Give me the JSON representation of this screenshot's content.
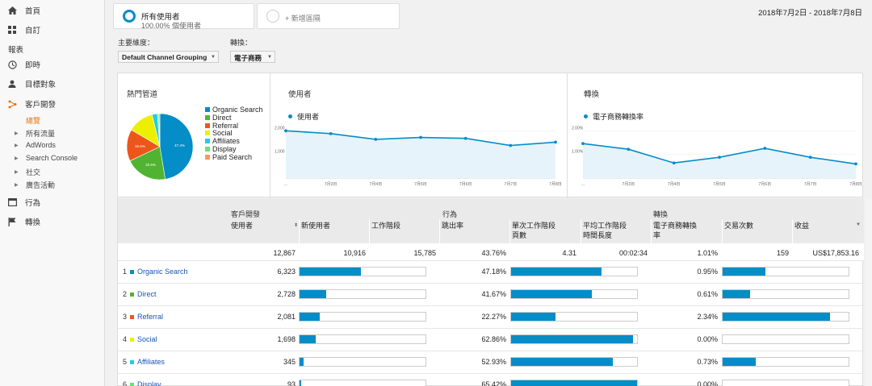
{
  "sidebar": {
    "items": [
      {
        "label": "首頁",
        "icon": "home-icon"
      },
      {
        "label": "自訂",
        "icon": "grid-icon"
      },
      {
        "label": "即時",
        "icon": "clock-icon"
      },
      {
        "label": "目標對象",
        "icon": "person-icon"
      },
      {
        "label": "客戶開發",
        "icon": "acquisition-icon"
      },
      {
        "label": "行為",
        "icon": "behavior-icon"
      },
      {
        "label": "轉換",
        "icon": "flag-icon"
      }
    ],
    "section": "報表",
    "active_sub": "總覽",
    "subitems": [
      "所有流量",
      "AdWords",
      "Search Console",
      "社交",
      "廣告活動"
    ]
  },
  "segments": {
    "primary_title": "所有使用者",
    "primary_sub": "100.00% 個使用者",
    "add_label": "+ 新增區隔"
  },
  "date_range": "2018年7月2日 - 2018年7月8日",
  "controls": {
    "primary_dim_label": "主要維度：",
    "primary_dim_value": "Default Channel Grouping",
    "conversion_label": "轉換：",
    "conversion_value": "電子商務"
  },
  "panels": {
    "pie_title": "熱門管道",
    "users_title": "使用者",
    "users_series": "使用者",
    "conv_title": "轉換",
    "conv_series": "電子商務轉換率"
  },
  "chart_data": [
    {
      "type": "pie",
      "title": "熱門管道",
      "categories": [
        "Organic Search",
        "Direct",
        "Referral",
        "Social",
        "Affiliates",
        "Display",
        "Paid Search"
      ],
      "values": [
        47.4,
        20.5,
        15.6,
        12.7,
        2.6,
        0.7,
        0.5
      ],
      "slice_labels": [
        "47.4%",
        "20.5%",
        "15.6%"
      ],
      "colors": [
        "#058dc7",
        "#50b432",
        "#ed561b",
        "#edef00",
        "#24cbe5",
        "#64e572",
        "#ff9655"
      ],
      "legend": "right"
    },
    {
      "type": "area",
      "title": "使用者",
      "series": [
        {
          "name": "使用者",
          "values": [
            2000,
            1880,
            1640,
            1720,
            1680,
            1380,
            1520
          ]
        }
      ],
      "x": [
        "...",
        "7月3日",
        "7月4日",
        "7月5日",
        "7月6日",
        "7月7日",
        "7月8日"
      ],
      "y_ticks": [
        "2,000",
        "1,000"
      ],
      "ylim": [
        0,
        2250
      ]
    },
    {
      "type": "area",
      "title": "轉換",
      "series": [
        {
          "name": "電子商務轉換率",
          "values": [
            1.46,
            1.22,
            0.64,
            0.88,
            1.26,
            0.88,
            0.6
          ]
        }
      ],
      "x": [
        "...",
        "7月3日",
        "7月4日",
        "7月5日",
        "7月6日",
        "7月7日",
        "7月8日"
      ],
      "y_ticks": [
        "2.00%",
        "1.00%"
      ],
      "ylim": [
        0,
        2.25
      ]
    }
  ],
  "table": {
    "groups": [
      "客戶開發",
      "行為",
      "轉換"
    ],
    "headers": [
      "使用者",
      "新使用者",
      "工作階段",
      "跳出率",
      "單次工作階段\n頁數",
      "平均工作階段\n時間長度",
      "電子商務轉換\n率",
      "交易次數",
      "收益"
    ],
    "totals": [
      "12,867",
      "10,916",
      "15,785",
      "43.76%",
      "4.31",
      "00:02:34",
      "1.01%",
      "159",
      "US$17,853.16"
    ],
    "rows": [
      {
        "num": "1",
        "name": "Organic Search",
        "color": "#058dc7",
        "users": "6,323",
        "new_users_frac": 0.49,
        "bounce": "47.18%",
        "pages_frac": 0.72,
        "conv": "0.95%",
        "tx_frac": 0.34
      },
      {
        "num": "2",
        "name": "Direct",
        "color": "#50b432",
        "users": "2,728",
        "new_users_frac": 0.21,
        "bounce": "41.67%",
        "pages_frac": 0.64,
        "conv": "0.61%",
        "tx_frac": 0.22
      },
      {
        "num": "3",
        "name": "Referral",
        "color": "#ed561b",
        "users": "2,081",
        "new_users_frac": 0.16,
        "bounce": "22.27%",
        "pages_frac": 0.35,
        "conv": "2.34%",
        "tx_frac": 0.85
      },
      {
        "num": "4",
        "name": "Social",
        "color": "#edef00",
        "users": "1,698",
        "new_users_frac": 0.13,
        "bounce": "62.86%",
        "pages_frac": 0.97,
        "conv": "0.00%",
        "tx_frac": 0.0
      },
      {
        "num": "5",
        "name": "Affiliates",
        "color": "#24cbe5",
        "users": "345",
        "new_users_frac": 0.03,
        "bounce": "52.93%",
        "pages_frac": 0.81,
        "conv": "0.73%",
        "tx_frac": 0.26
      },
      {
        "num": "6",
        "name": "Display",
        "color": "#64e572",
        "users": "93",
        "new_users_frac": 0.01,
        "bounce": "65.42%",
        "pages_frac": 1.0,
        "conv": "0.00%",
        "tx_frac": 0.0
      }
    ]
  }
}
